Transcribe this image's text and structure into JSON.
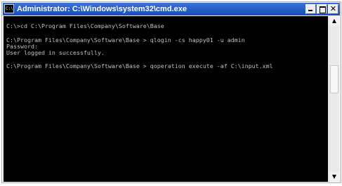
{
  "window": {
    "title": "Administrator: C:\\Windows\\system32\\cmd.exe",
    "icon_name": "cmd-icon",
    "icon_text": "C:\\",
    "controls": {
      "minimize": "minimize-icon",
      "maximize": "maximize-icon",
      "close_glyph": "✕"
    }
  },
  "console": {
    "lines": [
      "C:\\>cd C:\\Program Files\\Company\\Software\\Base",
      "C:\\Program Files\\Company\\Software\\Base > qlogin -cs happy01 -u admin",
      "Password:",
      "User logged in successfully.",
      "C:\\Program Files\\Company\\Software\\Base > qoperation execute -af C:\\input.xml"
    ]
  },
  "scrollbar": {
    "up_glyph": "▲",
    "down_glyph": "▼"
  },
  "colors": {
    "title_bar": "#1a4fb8",
    "console_bg": "#000000",
    "console_text": "#c0c0c0"
  }
}
